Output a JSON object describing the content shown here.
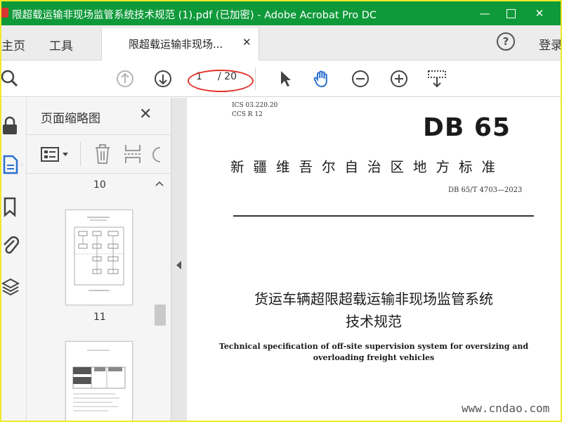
{
  "colors": {
    "titlebar": "#0f9a3a",
    "accent_blue": "#2a6fd1",
    "annotation_red": "#e3322a",
    "frame_yellow": "#f0e92a"
  },
  "window": {
    "title": "限超载运输非现场监管系统技术规范 (1).pdf  (已加密)  - Adobe Acrobat Pro DC",
    "minimize": "—",
    "close": "✕"
  },
  "tabs": {
    "home": "主页",
    "tools": "工具",
    "document": "限超载运输非现场...",
    "document_close": "✕",
    "help": "?",
    "login": "登录"
  },
  "toolbar": {
    "icons": [
      "search-icon",
      "page-up-icon",
      "page-down-icon",
      "select-cursor-icon",
      "hand-tool-icon",
      "zoom-out-icon",
      "zoom-in-icon",
      "marquee-zoom-icon"
    ],
    "current_page": "1",
    "total_pages": "/ 20"
  },
  "rail": {
    "icons": [
      "lock-icon",
      "page-thumbnails-icon",
      "bookmark-icon",
      "attachment-icon",
      "layers-icon"
    ]
  },
  "thumbnail_panel": {
    "title": "页面缩略图",
    "close": "✕",
    "labels": [
      "10",
      "11"
    ]
  },
  "document": {
    "ics": "ICS  03.220.20",
    "ccs": "CCS  R 12",
    "db_mark": "DB 65",
    "org": "新疆维吾尔自治区地方标准",
    "number": "DB 65/T 4703—2023",
    "title_line1": "货运车辆超限超载运输非现场监管系统",
    "title_line2": "技术规范",
    "en_line1": "Technical specification of off-site supervision system for oversizing and",
    "en_line2": "overloading freight vehicles"
  },
  "watermark": "www.cndao.com"
}
